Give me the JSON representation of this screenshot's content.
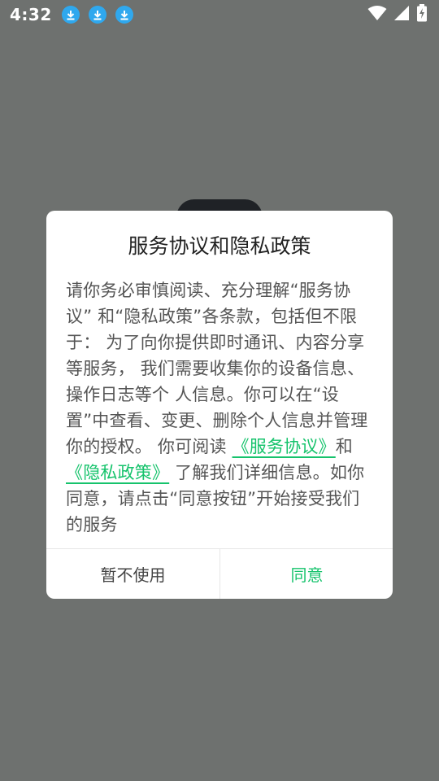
{
  "status_bar": {
    "time": "4:32",
    "download_icons": [
      "download-icon",
      "download-icon",
      "download-icon"
    ],
    "right_icons": [
      "wifi-icon",
      "cell-signal-icon",
      "battery-charging-icon"
    ]
  },
  "dialog": {
    "title": "服务协议和隐私政策",
    "body_part1": "请你务必审慎阅读、充分理解“服务协议” 和“隐私政策”各条款，包括但不限于： 为了向你提供即时通讯、内容分享等服务， 我们需要收集你的设备信息、操作日志等个 人信息。你可以在“设置”中查看、变更、删除个人信息并管理你的授权。 你可阅读 ",
    "link_service": "《服务协议》",
    "body_and": "和",
    "link_privacy": "《隐私政策》",
    "body_part2": " 了解我们详细信息。如你同意，请点击“同意按钮”开始接受我们的服务",
    "decline_label": "暂不使用",
    "agree_label": "同意"
  },
  "colors": {
    "accent": "#16c36c",
    "overlay": "#6e716f",
    "download_badge": "#2fa8ee"
  }
}
